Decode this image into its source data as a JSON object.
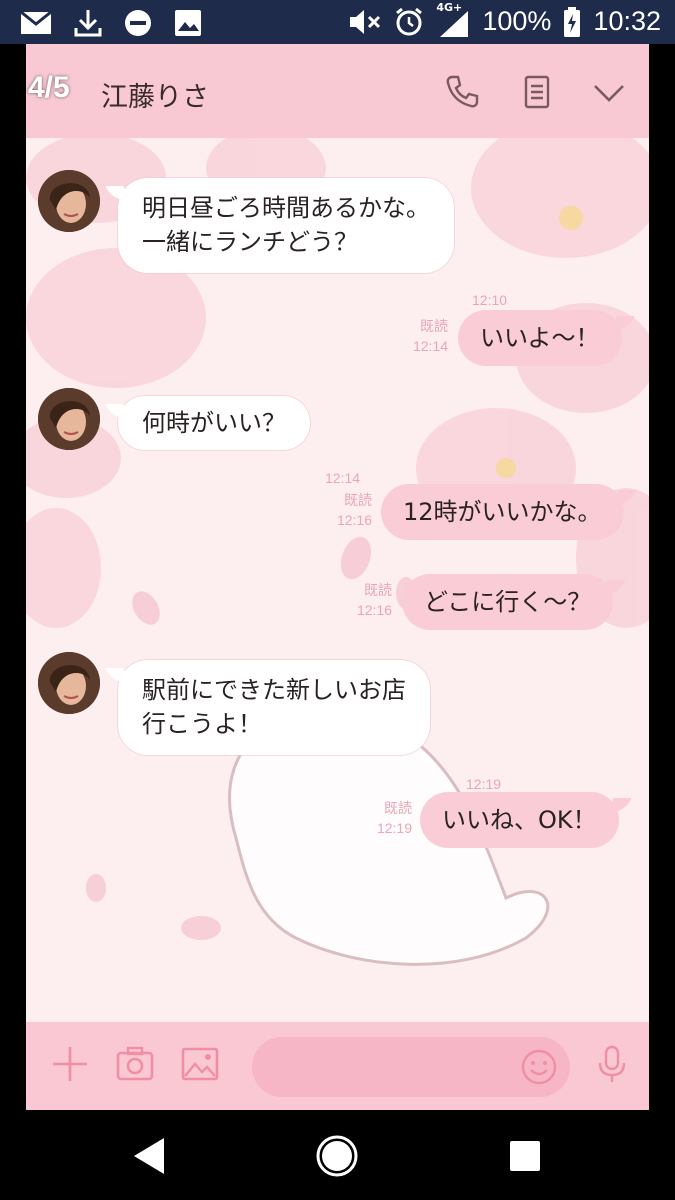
{
  "status_bar": {
    "battery": "100%",
    "time": "10:32",
    "network": "4G+",
    "icons": [
      "mail-icon",
      "download-icon",
      "dnd-icon",
      "image-icon",
      "mute-icon",
      "alarm-icon",
      "signal-icon",
      "battery-charging-icon"
    ]
  },
  "header": {
    "page_counter": "4/5",
    "title": "江藤りさ",
    "icons": [
      "phone-icon",
      "notes-icon",
      "chevron-down-icon"
    ]
  },
  "messages": [
    {
      "dir": "in",
      "lines": [
        "明日昼ごろ時間あるかな。",
        "一緒にランチどう？"
      ],
      "time": "12:10"
    },
    {
      "dir": "out",
      "lines": [
        "いいよ〜！"
      ],
      "read": "既読",
      "time": "12:14"
    },
    {
      "dir": "in",
      "lines": [
        "何時がいい？"
      ],
      "time": "12:14"
    },
    {
      "dir": "out",
      "lines": [
        "12時がいいかな。"
      ],
      "read": "既読",
      "time": "12:16"
    },
    {
      "dir": "out",
      "lines": [
        "どこに行く〜？"
      ],
      "read": "既読",
      "time": "12:16"
    },
    {
      "dir": "in",
      "lines": [
        "駅前にできた新しいお店",
        "行こうよ！"
      ],
      "time": "12:19"
    },
    {
      "dir": "out",
      "lines": [
        "いいね、OK！"
      ],
      "read": "既読",
      "time": "12:19"
    }
  ],
  "input_bar": {
    "icons": [
      "plus-icon",
      "camera-icon",
      "gallery-icon",
      "emoji-icon",
      "mic-icon"
    ],
    "placeholder": ""
  },
  "nav_bar": {
    "icons": [
      "back-icon",
      "home-icon",
      "recents-icon"
    ]
  },
  "colors": {
    "header": "#f8c9d3",
    "bubble_out": "#f9ccd6",
    "bubble_in": "#ffffff",
    "meta_text": "#e9a7b5",
    "status_bar": "#1e2b4a"
  }
}
